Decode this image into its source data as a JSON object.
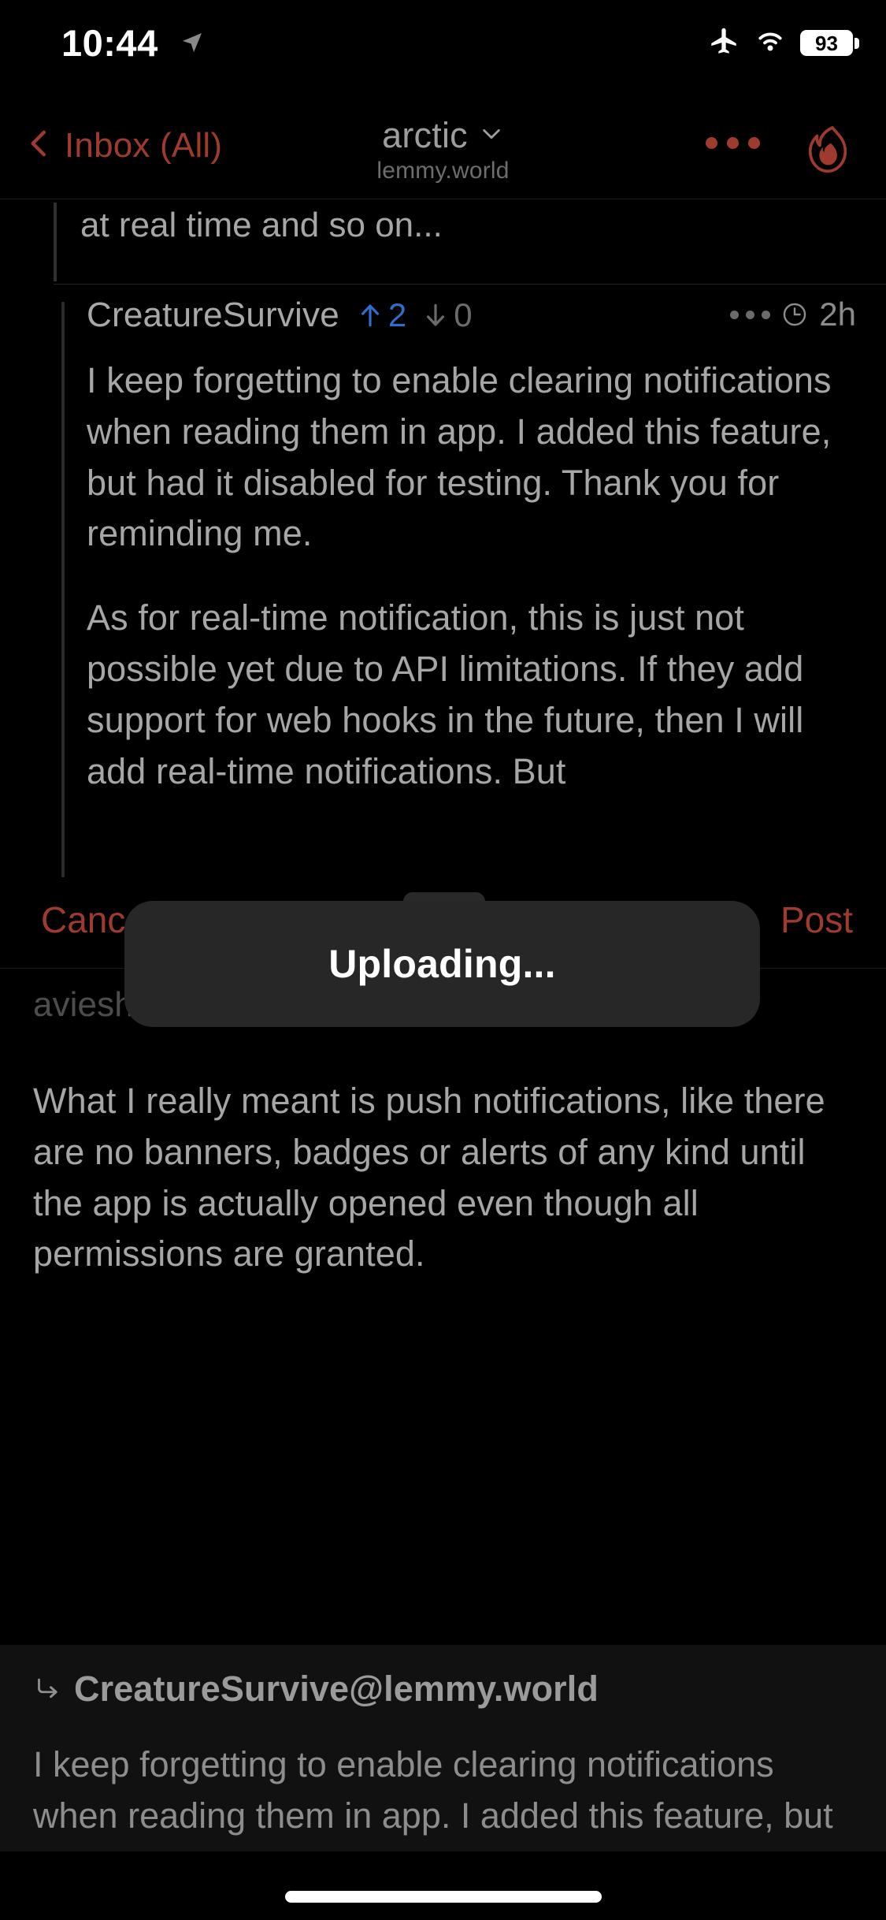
{
  "status_bar": {
    "time": "10:44",
    "location_icon": "location-arrow-icon",
    "airplane_icon": "airplane-mode-icon",
    "wifi_icon": "wifi-icon",
    "battery_percent": "93"
  },
  "nav_bar": {
    "back_label": "Inbox (All)",
    "back_icon": "chevron-left-icon",
    "title": "arctic",
    "title_chevron_icon": "chevron-down-icon",
    "subtitle": "lemmy.world",
    "more_icon": "ellipsis-icon",
    "app_icon": "flame-icon",
    "accent_color": "#9e3b2e"
  },
  "quote": {
    "text": "at real time and so on..."
  },
  "comment": {
    "author": "CreatureSurvive",
    "upvote_icon": "arrow-up-icon",
    "upvotes": "2",
    "downvote_icon": "arrow-down-icon",
    "downvotes": "0",
    "more_icon": "ellipsis-icon",
    "clock_icon": "clock-icon",
    "age": "2h",
    "upvote_color": "#2f6ecb",
    "paragraphs": [
      "I keep forgetting to enable clearing notifications when reading them in app. I added this feature, but had it disabled for testing. Thank you for reminding me.",
      "As for real-time notification, this is just not possible yet due to API limitations. If they add support for web hooks in the future, then I will add real-time notifications. But"
    ]
  },
  "compose": {
    "cancel_label": "Cancel",
    "post_label": "Post",
    "recipient": "avieshek@lemmy.world",
    "body": "What I really meant is push notifications, like there are no banners, badges or alerts of any kind until the app is actually opened even though all permissions are granted."
  },
  "modal": {
    "label": "Uploading...",
    "handle_icon": "drag-handle-icon",
    "background_color": "#272727"
  },
  "bottom_preview": {
    "reply_arrow_icon": "reply-arrow-icon",
    "user": "CreatureSurvive@lemmy.world",
    "body": "I keep forgetting to enable clearing notifications when reading them in app. I added this feature, but had it disabled for"
  },
  "home_indicator": "home-indicator"
}
